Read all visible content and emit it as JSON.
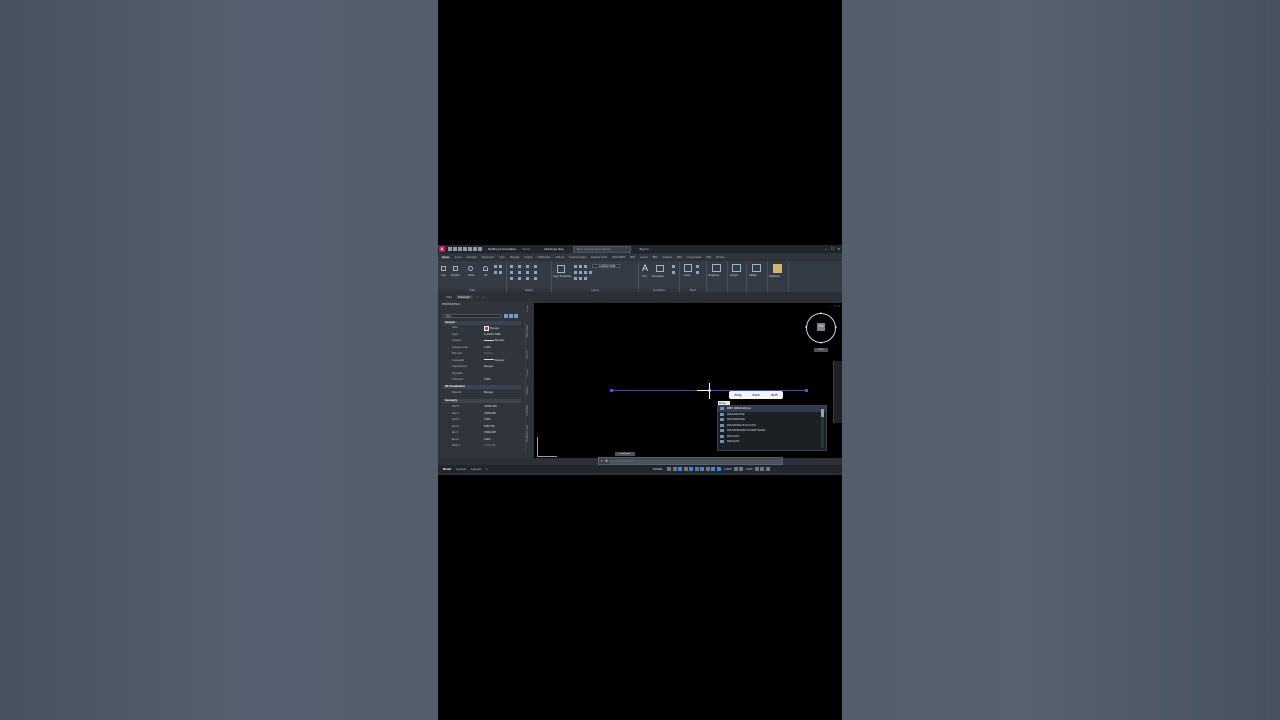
{
  "titlebar": {
    "logo": "A",
    "workspace": "Drafting & Annotation",
    "share": "Share",
    "document": "Drawing1.dwg",
    "search_placeholder": "Type a keyword or phrase",
    "signin": "Sign In"
  },
  "ribbon_tabs": [
    "Home",
    "Insert",
    "Annotate",
    "Parametric",
    "View",
    "Manage",
    "Output",
    "Collaborate",
    "Add-ins",
    "Featured Apps",
    "Express Tools",
    "Water(BIM)",
    "BIM",
    "Layout",
    "BIM",
    "Analysis",
    "BIM",
    "Components",
    "BIM",
    "Review"
  ],
  "ribbon": {
    "draw_tools": [
      "Line",
      "Polyline",
      "Circle",
      "Arc"
    ],
    "draw_group": "Draw",
    "modify_group": "Modify",
    "layer_properties": "Layer Properties",
    "layer_current": "C-ANNO-TABL",
    "layers_group": "Layers",
    "text": "Text",
    "dimension": "Dimension",
    "annotation_group": "Annotation",
    "insert": "Insert",
    "block_group": "Block",
    "properties": "Properties",
    "groups": "Groups",
    "utilities": "Utilities",
    "clipboard": "Clipboard"
  },
  "file_tabs": [
    "Start",
    "Drawing1*"
  ],
  "properties_panel": {
    "title": "PROPERTIES",
    "selection": "Line",
    "general_title": "General",
    "general": [
      {
        "key": "Color",
        "value": "ByLayer"
      },
      {
        "key": "Layer",
        "value": "C-ANNO-TABL"
      },
      {
        "key": "Linetype",
        "value": "ByLayer"
      },
      {
        "key": "Linetype scale",
        "value": "1.000"
      },
      {
        "key": "Plot style",
        "value": "ByColor"
      },
      {
        "key": "Lineweight",
        "value": "ByLayer"
      },
      {
        "key": "Transparency",
        "value": "ByLayer"
      },
      {
        "key": "Hyperlink",
        "value": ""
      },
      {
        "key": "Thickness",
        "value": "0.000"
      }
    ],
    "viz_title": "3D Visualization",
    "viz": [
      {
        "key": "Material",
        "value": "ByLayer"
      }
    ],
    "geometry_title": "Geometry",
    "geometry": [
      {
        "key": "Start X",
        "value": "-97087.609"
      },
      {
        "key": "Start Y",
        "value": "37262.525"
      },
      {
        "key": "Start Z",
        "value": "0.000"
      },
      {
        "key": "End X",
        "value": "5181.576"
      },
      {
        "key": "End Y",
        "value": "37262.525"
      },
      {
        "key": "End Z",
        "value": "0.000"
      },
      {
        "key": "Delta X",
        "value": "37565.185"
      }
    ],
    "side_tabs": [
      "Design",
      "Object Data",
      "Parcels",
      "Display",
      "Analyst",
      "Point Data",
      "Production Tools"
    ]
  },
  "viewport": {
    "viewcube": {
      "face": "TOP",
      "n": "N",
      "s": "S",
      "w": "W",
      "e": "E"
    },
    "wcs": "WCS",
    "suggestions": [
      "drag",
      "draw",
      "draft"
    ],
    "typed": "Drag",
    "autocomplete": [
      "DBX (DRAGDLG)",
      "DRAGMODE",
      "DRAWMODE",
      "DRAWINGUNLOCKS",
      "DRAWINGRECOVERYHIDE",
      "DRAGP1",
      "DRAGP2"
    ],
    "cmd_hint": "Command:",
    "cmd_placeholder": "Type a command"
  },
  "statusbar": {
    "tabs": [
      "Model",
      "Layout1",
      "Layout2"
    ],
    "model_label": "MODEL",
    "scale": "1:1000",
    "decimal": "3.500"
  }
}
